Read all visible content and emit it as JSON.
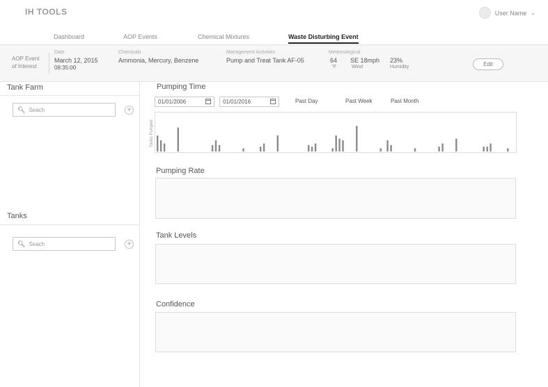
{
  "app": {
    "brand": "IH TOOLS",
    "user_name": "User Name"
  },
  "nav": {
    "tabs": [
      {
        "label": "Dashboard",
        "active": false
      },
      {
        "label": "AOP Events",
        "active": false
      },
      {
        "label": "Chemical Mixtures",
        "active": false
      },
      {
        "label": "Waste Disturbing Event",
        "active": true
      }
    ]
  },
  "info": {
    "aop_line1": "AOP Event",
    "aop_line2": "of Interest",
    "date_label": "Date",
    "date_value": "March 12, 2015",
    "time_value": "08:35:00",
    "chemicals_label": "Chemicals",
    "chemicals_value": "Ammonia, Mercury, Benzene",
    "mgmt_label": "Management Activities",
    "mgmt_value": "Pump and Treat Tank AF-05",
    "meteo_label": "Meteorological",
    "temp_value": "64",
    "temp_unit": "°F",
    "wind_value": "SE 18mph",
    "wind_label": "Wind",
    "humidity_value": "23%",
    "humidity_label": "Humidity",
    "edit_label": "Edit"
  },
  "left": {
    "tank_farm_title": "Tank Farm",
    "tank_farm_placeholder": "Seach",
    "tanks_title": "Tanks",
    "tanks_placeholder": "Seach"
  },
  "main": {
    "pumping_time_title": "Pumping Time",
    "start_date": "01/01/2006",
    "end_date": "01/01/2016",
    "range_day": "Past Day",
    "range_week": "Past Week",
    "range_month": "Past Month",
    "pumping_rate_title": "Pumping Rate",
    "tank_levels_title": "Tank Levels",
    "confidence_title": "Confidence"
  },
  "chart_data": {
    "type": "bar",
    "ylabel": "Tanks Pumped",
    "xlabel": "",
    "values": [
      0.5,
      0.35,
      0.25,
      0,
      0,
      0,
      0.75,
      0,
      0,
      0,
      0,
      0,
      0,
      0,
      0,
      0,
      0.2,
      0.35,
      0.2,
      0,
      0,
      0,
      0,
      0,
      0,
      0.1,
      0,
      0,
      0,
      0,
      0.15,
      0.25,
      0,
      0,
      0,
      0.5,
      0,
      0,
      0,
      0,
      0,
      0,
      0,
      0,
      0.2,
      0.15,
      0.25,
      0,
      0,
      0,
      0,
      0.1,
      0.5,
      0.4,
      0.35,
      0,
      0,
      0,
      0.8,
      0,
      0,
      0,
      0,
      0,
      0,
      0.1,
      0,
      0.35,
      0.2,
      0,
      0,
      0,
      0,
      0,
      0,
      0.1,
      0,
      0,
      0,
      0,
      0,
      0,
      0.15,
      0.25,
      0,
      0,
      0,
      0.4,
      0,
      0,
      0,
      0,
      0,
      0,
      0,
      0.15,
      0.15,
      0.25,
      0,
      0,
      0,
      0,
      0.1
    ]
  }
}
